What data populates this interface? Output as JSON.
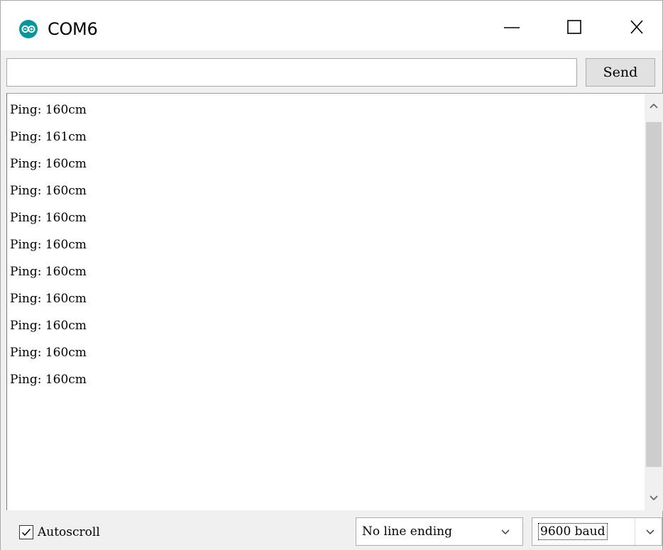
{
  "window": {
    "title": "COM6",
    "logo_icon": "arduino-logo-icon",
    "controls": [
      "minimize-icon",
      "maximize-icon",
      "close-icon"
    ]
  },
  "send_bar": {
    "input_value": "",
    "send_label": "Send"
  },
  "output": {
    "lines": [
      "Ping: 160cm",
      "Ping: 161cm",
      "Ping: 160cm",
      "Ping: 160cm",
      "Ping: 160cm",
      "Ping: 160cm",
      "Ping: 160cm",
      "Ping: 160cm",
      "Ping: 160cm",
      "Ping: 160cm",
      "Ping: 160cm"
    ]
  },
  "footer": {
    "autoscroll_label": "Autoscroll",
    "autoscroll_checked": true,
    "line_ending_selected": "No line ending",
    "baud_selected": "9600 baud"
  },
  "colors": {
    "logo": "#00979c",
    "scroll_thumb": "#cdcdcd",
    "window_bg": "#f0f0f0"
  }
}
